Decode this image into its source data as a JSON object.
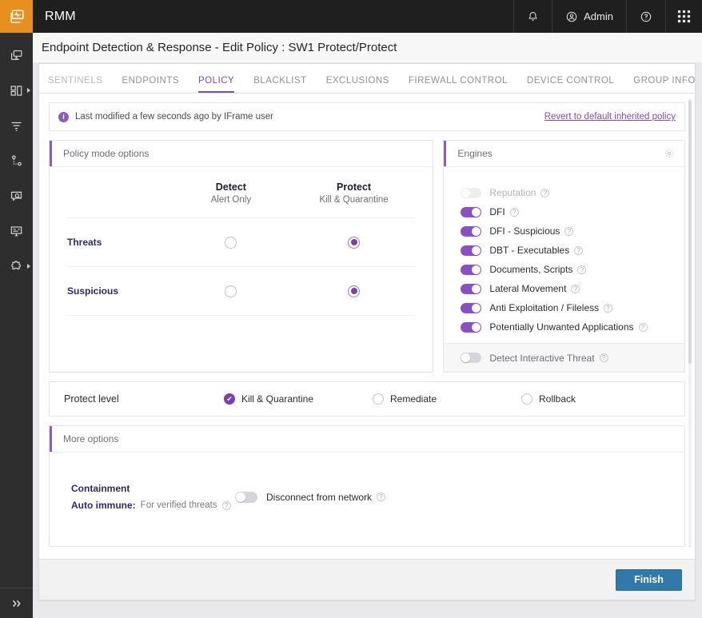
{
  "topbar": {
    "brand": "RMM",
    "logo_icon": "activity-monitor-icon",
    "bell_icon": "bell-icon",
    "user_icon": "user-circle-icon",
    "user_label": "Admin",
    "help_icon": "help-circle-icon",
    "apps_icon": "apps-grid-icon"
  },
  "rail": {
    "items": [
      {
        "icon": "devices-icon",
        "caret": false
      },
      {
        "icon": "dashboard-layout-icon",
        "caret": true
      },
      {
        "icon": "filter-icon",
        "caret": false
      },
      {
        "icon": "network-topology-icon",
        "caret": false
      },
      {
        "icon": "screen-search-icon",
        "caret": false
      },
      {
        "icon": "report-board-icon",
        "caret": false
      },
      {
        "icon": "puzzle-piece-icon",
        "caret": true
      }
    ],
    "expand_icon": "double-chevron-right-icon"
  },
  "page": {
    "title": "Endpoint Detection & Response - Edit Policy : SW1 Protect/Protect"
  },
  "tabs": [
    {
      "label": "SENTINELS",
      "active": false,
      "muted": true
    },
    {
      "label": "ENDPOINTS",
      "active": false,
      "muted": false
    },
    {
      "label": "POLICY",
      "active": true,
      "muted": false
    },
    {
      "label": "BLACKLIST",
      "active": false,
      "muted": false
    },
    {
      "label": "EXCLUSIONS",
      "active": false,
      "muted": false
    },
    {
      "label": "FIREWALL CONTROL",
      "active": false,
      "muted": false
    },
    {
      "label": "DEVICE CONTROL",
      "active": false,
      "muted": false
    },
    {
      "label": "GROUP INFO",
      "active": false,
      "muted": false
    }
  ],
  "notice": {
    "icon": "info-icon",
    "text": "Last modified a few seconds ago by IFrame user",
    "link": "Revert to default inherited policy"
  },
  "policy_mode": {
    "title": "Policy mode options",
    "columns": [
      {
        "name": "Detect",
        "sub": "Alert Only"
      },
      {
        "name": "Protect",
        "sub": "Kill & Quarantine"
      }
    ],
    "rows": [
      {
        "label": "Threats",
        "selected": "Protect"
      },
      {
        "label": "Suspicious",
        "selected": "Protect"
      }
    ]
  },
  "engines": {
    "title": "Engines",
    "gear_icon": "gear-icon",
    "help_icon": "question-mark-icon",
    "items": [
      {
        "label": "Reputation",
        "state": "disabled"
      },
      {
        "label": "DFI",
        "state": "on"
      },
      {
        "label": "DFI - Suspicious",
        "state": "on"
      },
      {
        "label": "DBT - Executables",
        "state": "on"
      },
      {
        "label": "Documents, Scripts",
        "state": "on"
      },
      {
        "label": "Lateral Movement",
        "state": "on"
      },
      {
        "label": "Anti Exploitation / Fileless",
        "state": "on"
      },
      {
        "label": "Potentially Unwanted Applications",
        "state": "on"
      }
    ],
    "footer": {
      "label": "Detect Interactive Threat",
      "state": "off"
    }
  },
  "protect_level": {
    "label": "Protect level",
    "options": [
      {
        "label": "Kill & Quarantine",
        "selected": true
      },
      {
        "label": "Remediate",
        "selected": false
      },
      {
        "label": "Rollback",
        "selected": false
      }
    ],
    "check_glyph": "✔"
  },
  "more_options": {
    "title": "More options",
    "containment_label": "Containment",
    "auto_immune_key": "Auto immune:",
    "auto_immune_value": "For verified threats",
    "disconnect_label": "Disconnect from network",
    "disconnect_state": "off"
  },
  "footer": {
    "finish_label": "Finish"
  },
  "colors": {
    "accent_purple": "#7a4fa3",
    "toggle_purple": "#8a4fc4",
    "logo_orange": "#e8901f",
    "primary_blue": "#3079a8",
    "topbar_dark": "#1f1f1f",
    "rail_dark": "#2e2e2e"
  }
}
